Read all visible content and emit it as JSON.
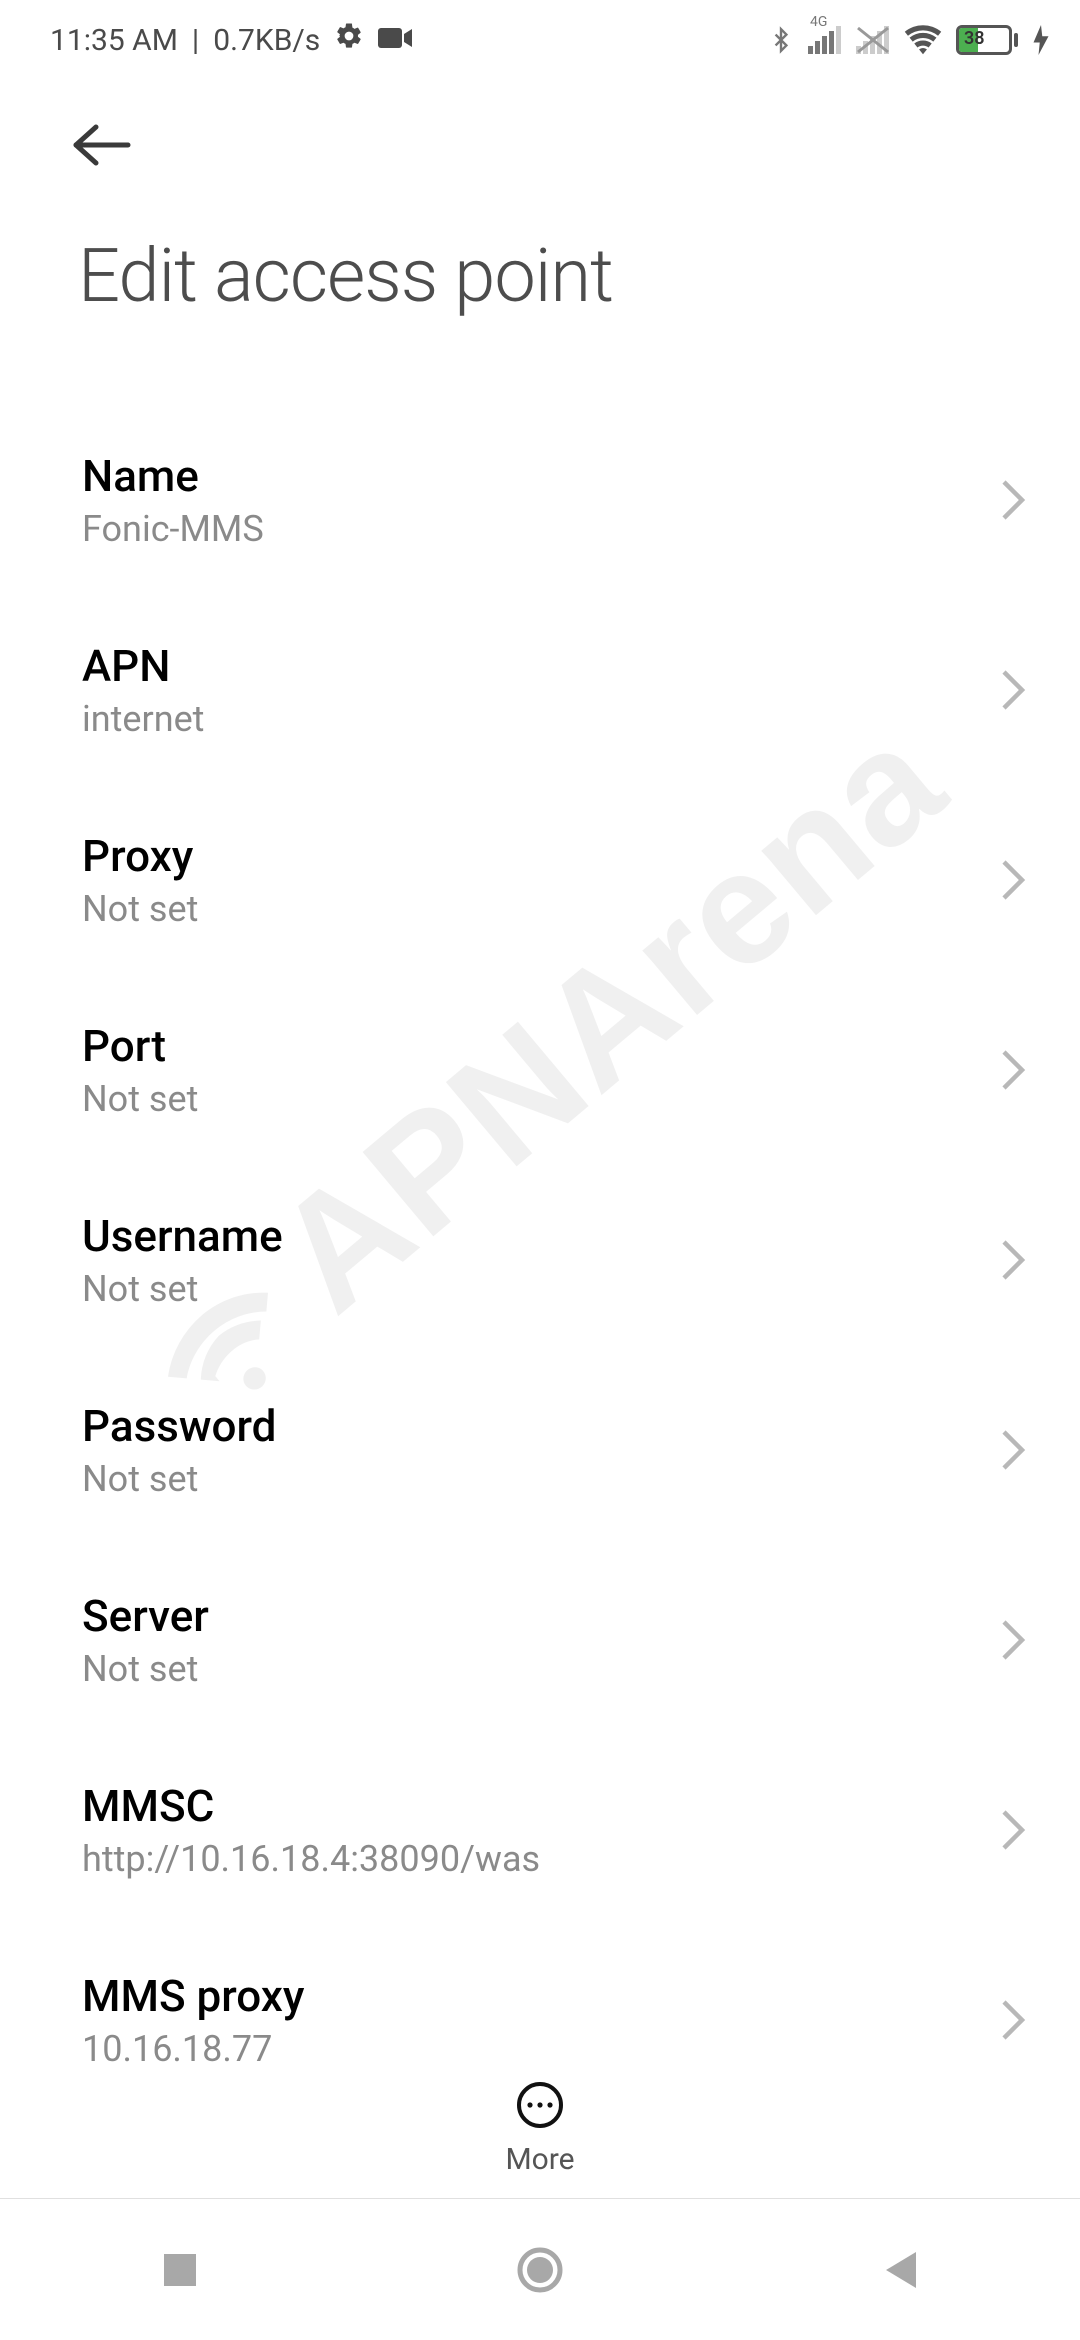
{
  "status": {
    "time": "11:35 AM",
    "sep": "|",
    "speed": "0.7KB/s",
    "network_label": "4G",
    "battery_pct": "38"
  },
  "page": {
    "title": "Edit access point"
  },
  "watermark": {
    "text": "APNArena"
  },
  "rows": [
    {
      "label": "Name",
      "value": "Fonic-MMS"
    },
    {
      "label": "APN",
      "value": "internet"
    },
    {
      "label": "Proxy",
      "value": "Not set"
    },
    {
      "label": "Port",
      "value": "Not set"
    },
    {
      "label": "Username",
      "value": "Not set"
    },
    {
      "label": "Password",
      "value": "Not set"
    },
    {
      "label": "Server",
      "value": "Not set"
    },
    {
      "label": "MMSC",
      "value": "http://10.16.18.4:38090/was"
    },
    {
      "label": "MMS proxy",
      "value": "10.16.18.77"
    }
  ],
  "toolbar": {
    "more_label": "More"
  }
}
